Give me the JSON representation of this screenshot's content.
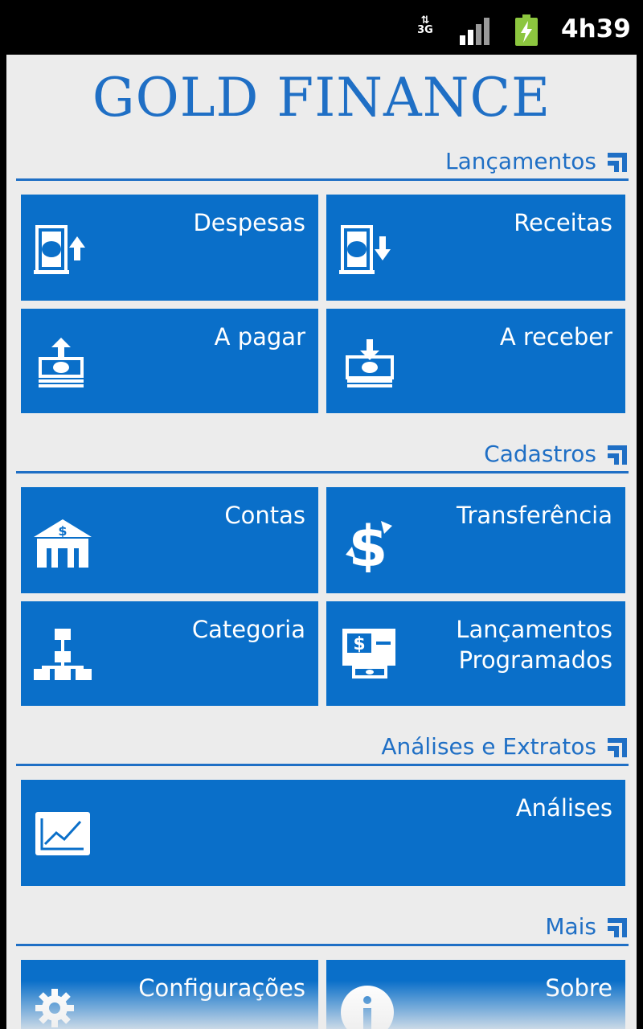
{
  "status_bar": {
    "network_type": "3G",
    "time": "4h39",
    "icons": [
      "network-3g-icon",
      "signal-strength-icon",
      "battery-charging-icon"
    ]
  },
  "app": {
    "logo_text": "GOLD FINANCE"
  },
  "colors": {
    "accent": "#1f6fc5",
    "tile": "#0a6fc9",
    "background": "#ececec"
  },
  "sections": {
    "lancamentos": {
      "title": "Lançamentos",
      "tiles": {
        "despesas": {
          "label": "Despesas",
          "icon": "expense-icon"
        },
        "receitas": {
          "label": "Receitas",
          "icon": "income-icon"
        },
        "a_pagar": {
          "label": "A pagar",
          "icon": "payable-icon"
        },
        "a_receber": {
          "label": "A receber",
          "icon": "receivable-icon"
        }
      }
    },
    "cadastros": {
      "title": "Cadastros",
      "tiles": {
        "contas": {
          "label": "Contas",
          "icon": "bank-icon"
        },
        "transferencia": {
          "label": "Transferência",
          "icon": "dollar-transfer-icon"
        },
        "categoria": {
          "label": "Categoria",
          "icon": "hierarchy-icon"
        },
        "lancamentos_programados": {
          "label_line1": "Lançamentos",
          "label_line2": "Programados",
          "icon": "scheduled-payment-icon"
        }
      }
    },
    "analises": {
      "title": "Análises e Extratos",
      "tiles": {
        "analises": {
          "label": "Análises",
          "icon": "chart-icon"
        }
      }
    },
    "mais": {
      "title": "Mais",
      "tiles": {
        "configuracoes": {
          "label": "Configurações",
          "icon": "gear-icon"
        },
        "sobre": {
          "label": "Sobre",
          "icon": "info-icon"
        }
      }
    }
  }
}
